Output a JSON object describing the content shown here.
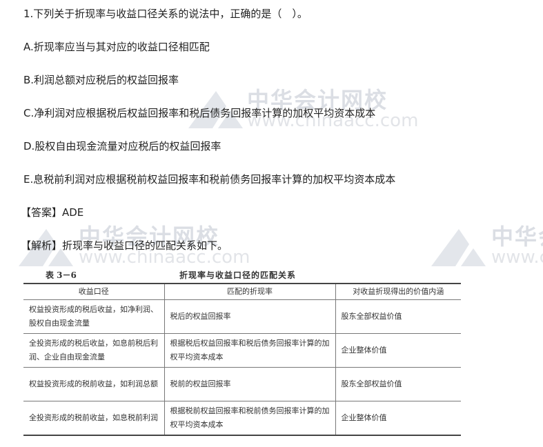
{
  "question": "1.下列关于折现率与收益口径关系的说法中，正确的是（　）。",
  "options": [
    "A.折现率应当与其对应的收益口径相匹配",
    "B.利润总额对应税后的权益回报率",
    "C.净利润对应根据税后权益回报率和税后债务回报率计算的加权平均资本成本",
    "D.股权自由现金流量对应税后的权益回报率",
    "E.息税前利润对应根据税前权益回报率和税前债务回报率计算的加权平均资本成本"
  ],
  "answer": "【答案】ADE",
  "analysis": "【解析】折现率与收益口径的匹配关系如下。",
  "watermark": {
    "brand": "中华会计网校",
    "url": "www.chinaacc.com"
  },
  "table": {
    "number": "表 3－6",
    "title": "折现率与收益口径的匹配关系",
    "headers": [
      "收益口径",
      "匹配的折现率",
      "对收益折现得出的价值内涵"
    ],
    "rows": [
      [
        "权益投资形成的税后收益，如净利润、股权自由现金流量",
        "税后的权益回报率",
        "股东全部权益价值"
      ],
      [
        "全投资形成的税后收益，如息前税后利润、企业自由现金流量",
        "根据税后权益回报率和税后债务回报率计算的加权平均资本成本",
        "企业整体价值"
      ],
      [
        "权益投资形成的税前收益，如利润总额",
        "税前的权益回报率",
        "股东全部权益价值"
      ],
      [
        "全投资形成的税前收益，如息税前利润",
        "根据税前权益回报率和税前债务回报率计算的加权平均资本成本",
        "企业整体价值"
      ]
    ]
  }
}
